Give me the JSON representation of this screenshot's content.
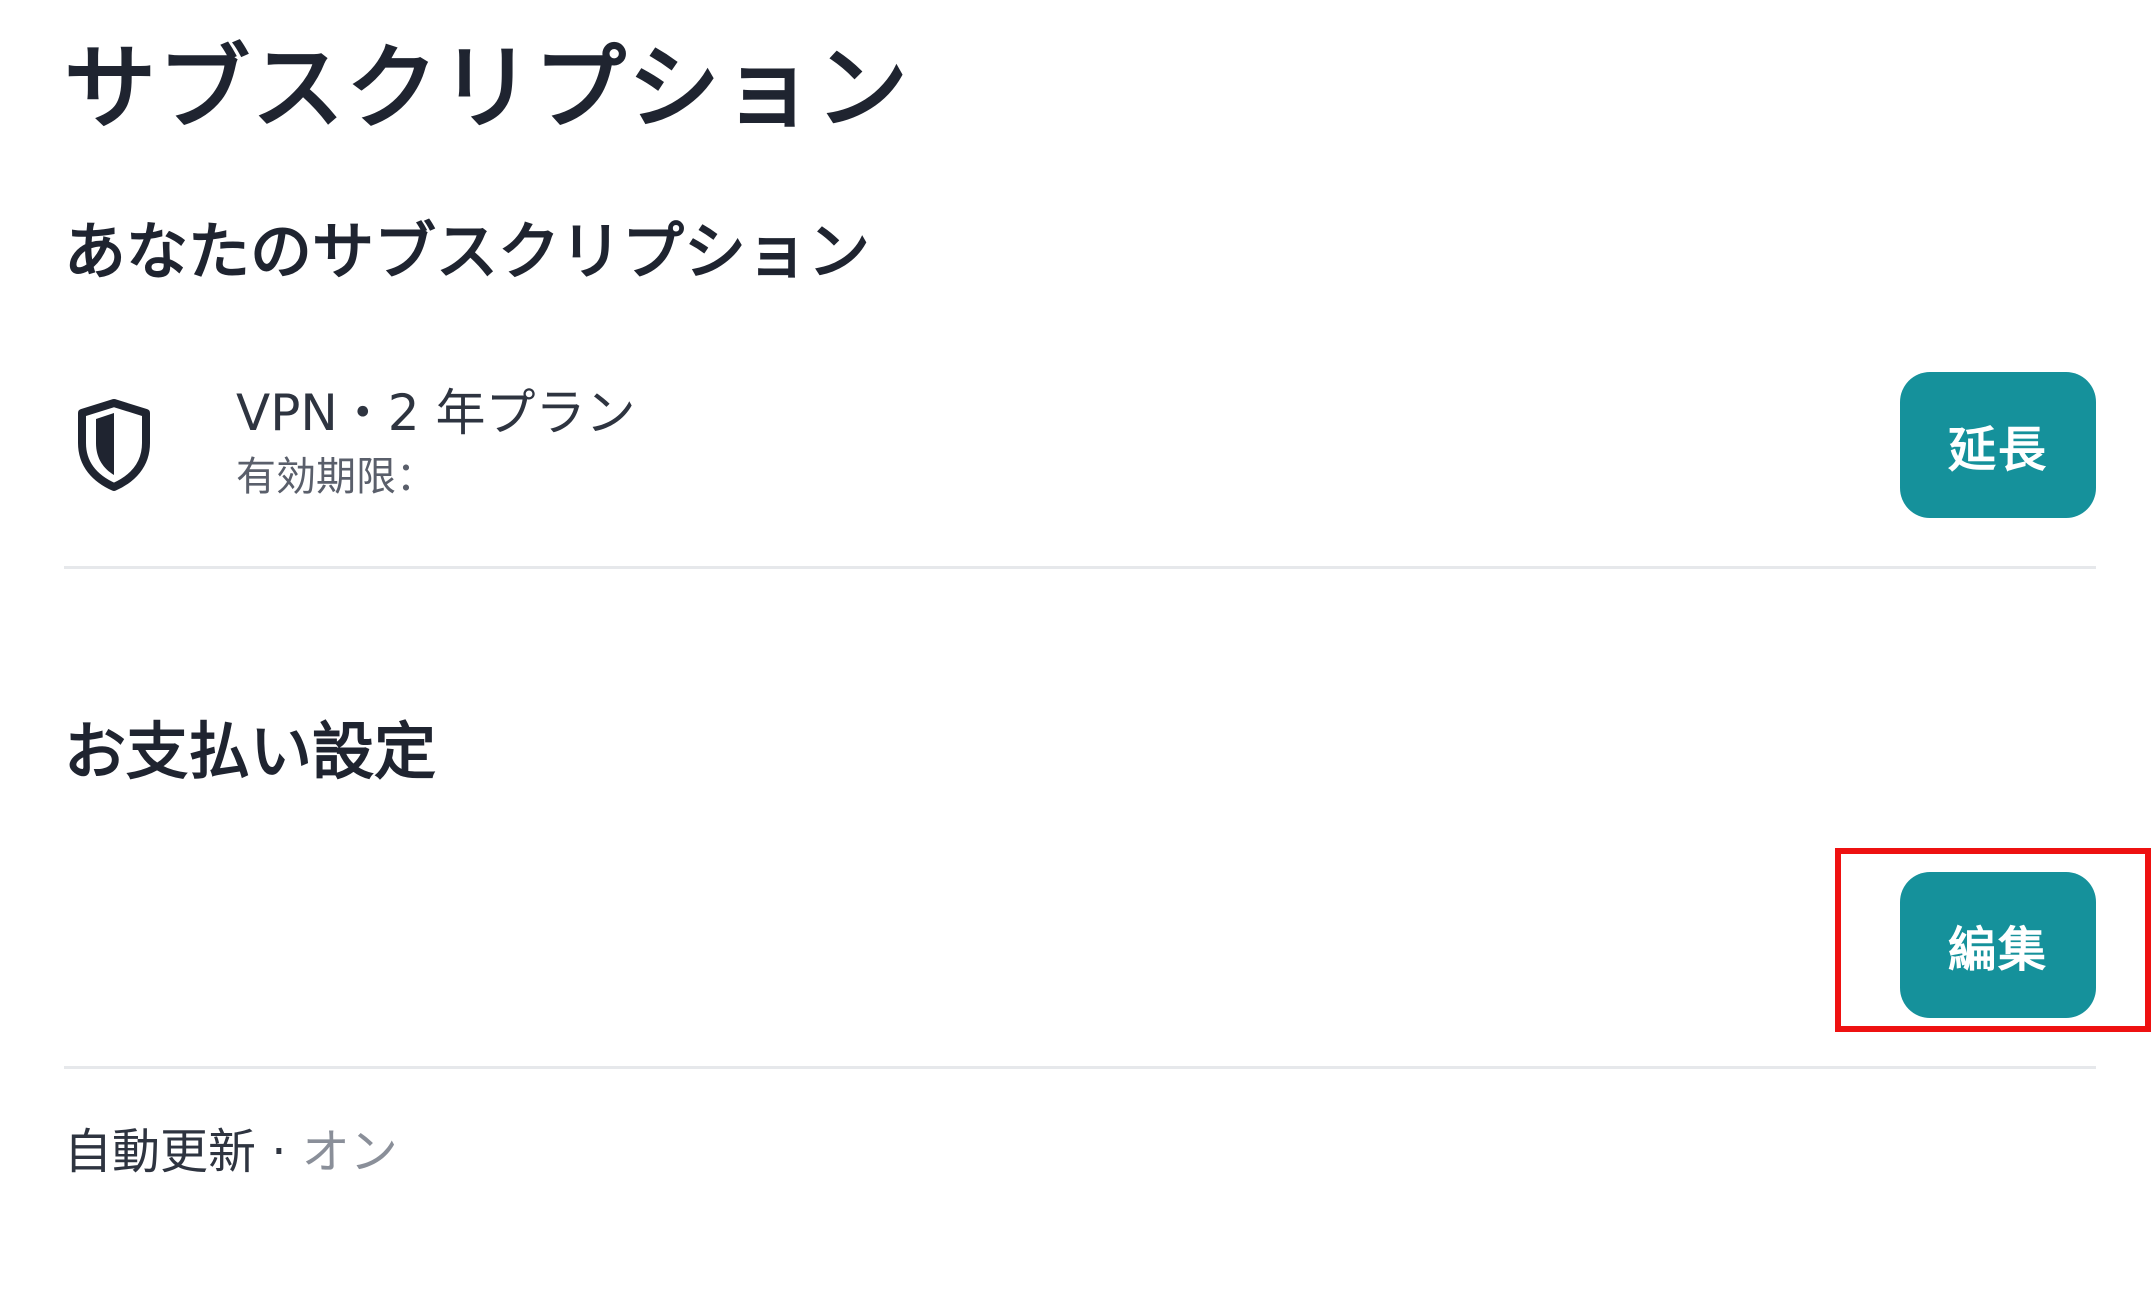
{
  "page": {
    "title": "サブスクリプション"
  },
  "subscriptions_section": {
    "heading": "あなたのサブスクリプション",
    "item": {
      "icon": "shield-icon",
      "name": "VPN・2 年プラン",
      "expiry_label": "有効期限：",
      "extend_button_label": "延長"
    }
  },
  "payment_section": {
    "heading": "お支払い設定",
    "edit_button_label": "編集",
    "auto_renew_label": "自動更新 · ",
    "auto_renew_value": "オン"
  },
  "colors": {
    "button_bg": "#15919b",
    "highlight": "#ee1111",
    "text": "#1f2430",
    "muted_text": "#8a8f99"
  }
}
